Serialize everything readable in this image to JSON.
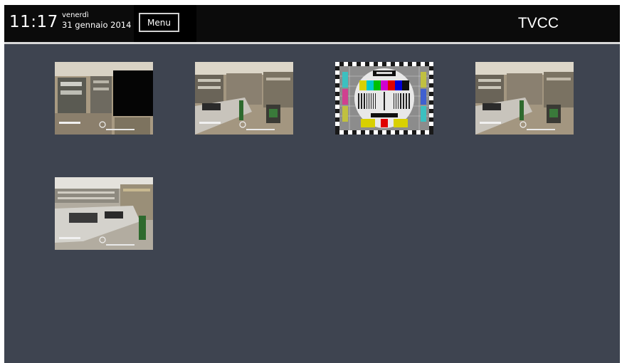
{
  "header": {
    "time": "11:17",
    "weekday": "venerdì",
    "date": "31 gennaio 2014",
    "menu_label": "Menu",
    "title": "TVCC"
  },
  "cameras": [
    {
      "id": "cam-1",
      "state": "live-feed-partially-obscured"
    },
    {
      "id": "cam-2",
      "state": "live-feed"
    },
    {
      "id": "cam-3",
      "state": "test-pattern"
    },
    {
      "id": "cam-4",
      "state": "live-feed"
    },
    {
      "id": "cam-5",
      "state": "live-feed"
    }
  ],
  "colors": {
    "background": "#3e4450",
    "topbar": "#0b0b0b",
    "text": "#ffffff"
  }
}
